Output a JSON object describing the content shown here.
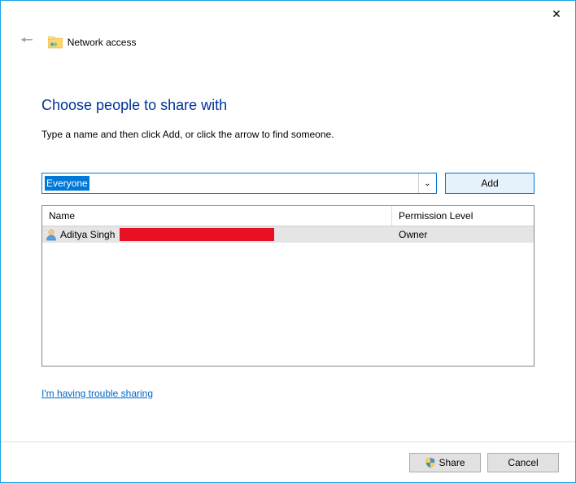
{
  "window": {
    "title": "Network access"
  },
  "heading": "Choose people to share with",
  "subtext": "Type a name and then click Add, or click the arrow to find someone.",
  "input": {
    "value": "Everyone",
    "add_label": "Add"
  },
  "columns": {
    "name": "Name",
    "permission": "Permission Level"
  },
  "users": [
    {
      "name": "Aditya Singh",
      "permission": "Owner"
    }
  ],
  "trouble_link": "I'm having trouble sharing",
  "footer": {
    "share": "Share",
    "cancel": "Cancel"
  }
}
